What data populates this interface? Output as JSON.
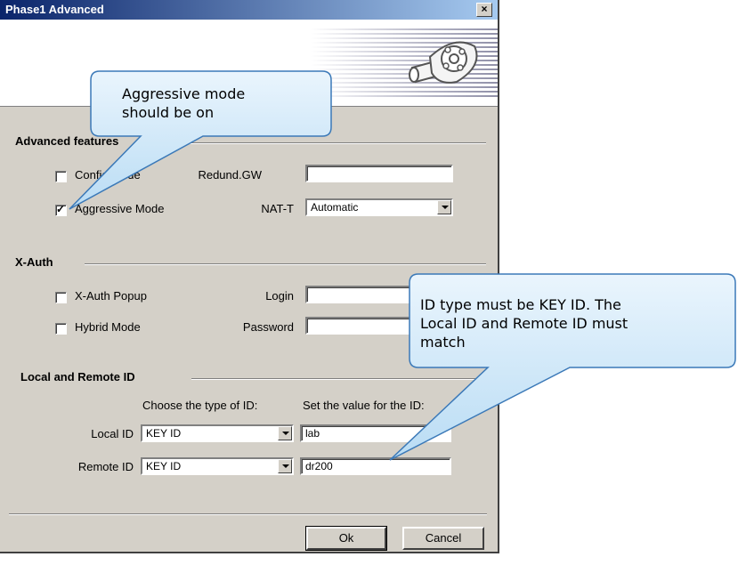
{
  "window": {
    "title": "Phase1 Advanced",
    "close_symbol": "×"
  },
  "banner": {
    "logo_icon": "tunnel-pipe-icon"
  },
  "advanced": {
    "title": "Advanced features",
    "config_mode_label": "Config Mode",
    "config_mode_checked": false,
    "aggressive_label": "Aggressive Mode",
    "aggressive_checked": true,
    "redund_label": "Redund.GW",
    "redund_value": "",
    "natt_label": "NAT-T",
    "natt_value": "Automatic"
  },
  "xauth": {
    "title": "X-Auth",
    "popup_label": "X-Auth Popup",
    "popup_checked": false,
    "hybrid_label": "Hybrid Mode",
    "hybrid_checked": false,
    "login_label": "Login",
    "login_value": "",
    "password_label": "Password",
    "password_value": ""
  },
  "ids": {
    "title": "Local and Remote ID",
    "type_header": "Choose the type of ID:",
    "value_header": "Set the value for the ID:",
    "local_label": "Local ID",
    "local_type": "KEY ID",
    "local_value": "lab",
    "remote_label": "Remote ID",
    "remote_type": "KEY ID",
    "remote_value": "dr200"
  },
  "buttons": {
    "ok": "Ok",
    "cancel": "Cancel"
  },
  "callouts": {
    "aggressive": {
      "line1": "Aggressive mode",
      "line2": "should be on"
    },
    "keyid": {
      "line1": "ID type must be KEY ID. The",
      "line2": "Local ID and Remote ID must",
      "line3": "match"
    }
  },
  "colors": {
    "title_bar_start": "#0a246a",
    "title_bar_end": "#a6caf0",
    "callout_fill": "#cfe6f7",
    "callout_stroke": "#3b79b8",
    "dialog_face": "#d4d0c8"
  }
}
